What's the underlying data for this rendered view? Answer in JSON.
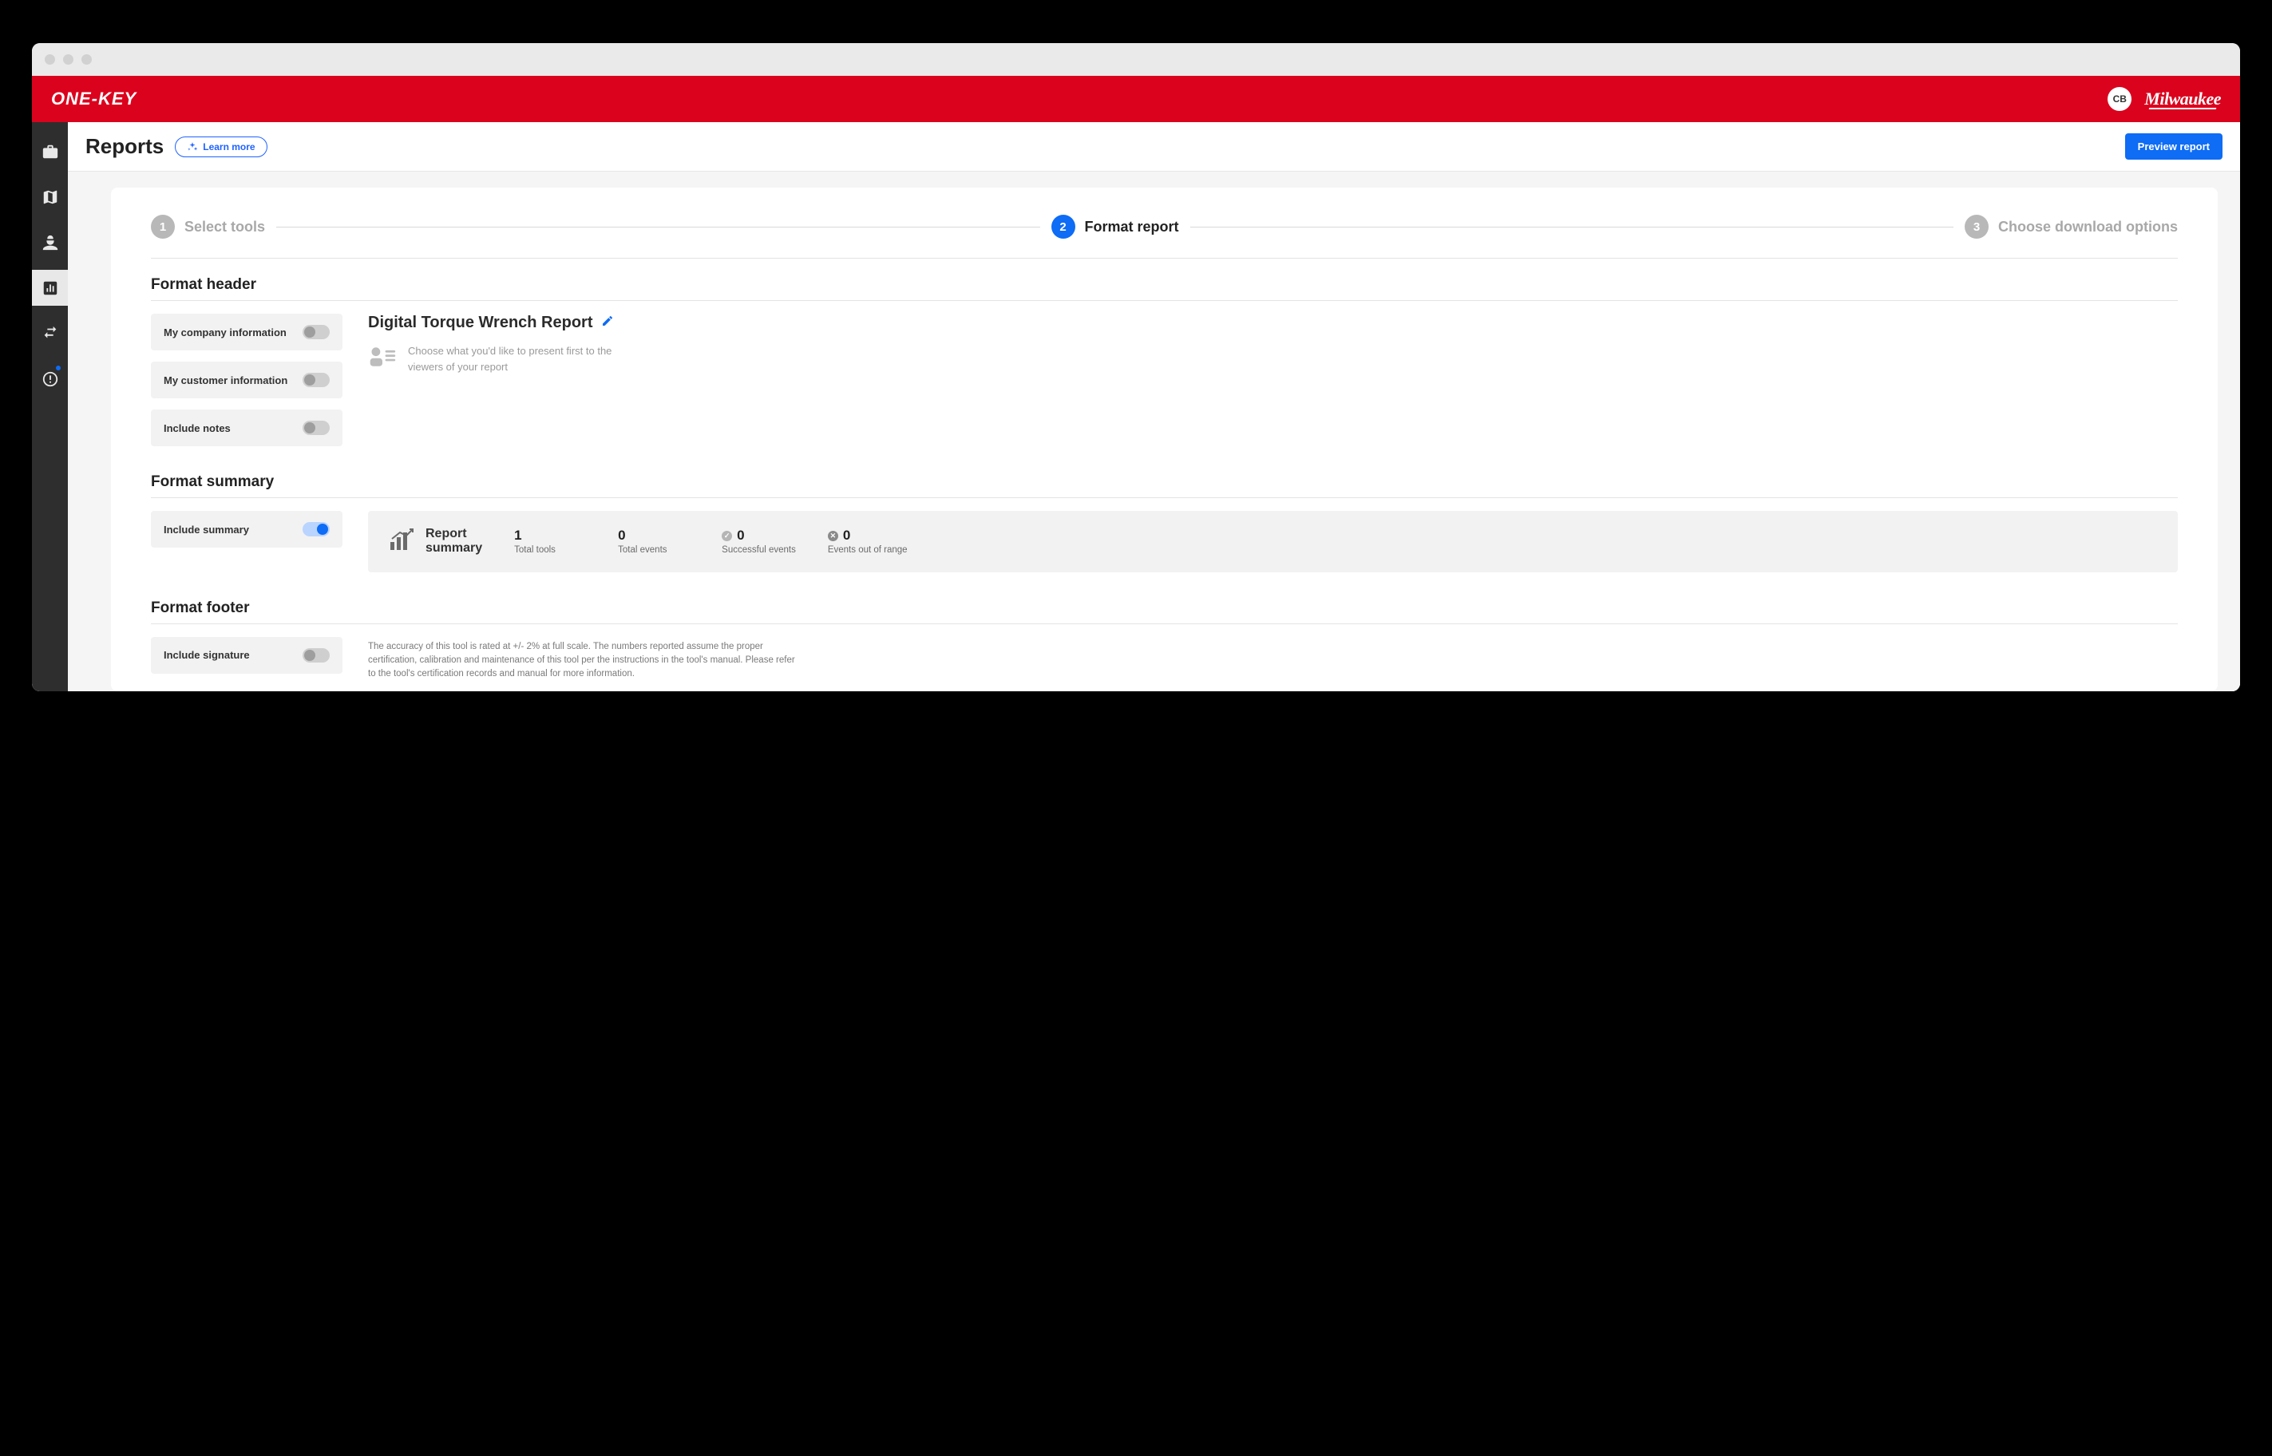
{
  "brand": {
    "app_name": "ONE-KEY",
    "company": "Milwaukee",
    "user_initials": "CB"
  },
  "page": {
    "title": "Reports",
    "learn_more": "Learn more",
    "preview_button": "Preview report"
  },
  "stepper": {
    "steps": [
      {
        "number": "1",
        "label": "Select tools",
        "active": false
      },
      {
        "number": "2",
        "label": "Format report",
        "active": true
      },
      {
        "number": "3",
        "label": "Choose download options",
        "active": false
      }
    ]
  },
  "header_section": {
    "title": "Format header",
    "toggles": [
      {
        "label": "My company information",
        "on": false
      },
      {
        "label": "My customer information",
        "on": false
      },
      {
        "label": "Include notes",
        "on": false
      }
    ],
    "report_title": "Digital Torque Wrench Report",
    "placeholder": "Choose what you'd like to present first to the viewers of your report"
  },
  "summary_section": {
    "title": "Format summary",
    "toggle_label": "Include summary",
    "toggle_on": true,
    "box_title": "Report summary",
    "stats": [
      {
        "value": "1",
        "label": "Total tools",
        "icon": "none"
      },
      {
        "value": "0",
        "label": "Total events",
        "icon": "none"
      },
      {
        "value": "0",
        "label": "Successful events",
        "icon": "check"
      },
      {
        "value": "0",
        "label": "Events out of range",
        "icon": "x"
      }
    ]
  },
  "footer_section": {
    "title": "Format footer",
    "toggle_label": "Include signature",
    "toggle_on": false,
    "disclaimer": "The accuracy of this tool is rated at +/- 2% at full scale. The numbers reported assume the proper certification, calibration and maintenance of this tool per the instructions in the tool's manual. Please refer to the tool's certification records and manual for more information."
  }
}
